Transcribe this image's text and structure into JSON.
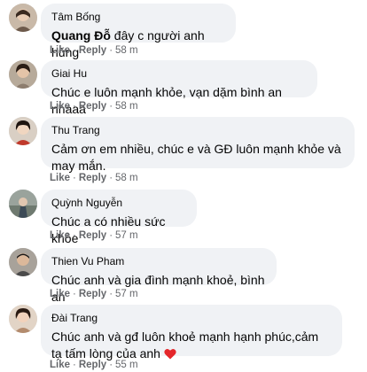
{
  "actions": {
    "like": "Like",
    "reply": "Reply",
    "separator": "·"
  },
  "comments": [
    {
      "author": "Tâm Bống",
      "mention": "Quang Đỗ",
      "text": " đây c người anh hùng",
      "time": "58 m"
    },
    {
      "author": "Giai Hu",
      "text": "Chúc e luôn mạnh khỏe, vạn dặm bình an nhaaa",
      "time": "58 m"
    },
    {
      "author": "Thu Trang",
      "text": "Cảm ơn em nhiều, chúc e và GĐ luôn mạnh khỏe và may mắn.",
      "time": "58 m"
    },
    {
      "author": "Quỳnh Nguyễn",
      "text": "Chúc a có nhiều sức khỏe",
      "time": "57 m"
    },
    {
      "author": "Thien Vu Pham",
      "text": "Chúc anh và gia đình mạnh khoẻ, bình an",
      "time": "57 m"
    },
    {
      "author": "Đài Trang",
      "text": "Chúc anh và gđ luôn khoẻ mạnh hạnh phúc,cảm tạ tấm lòng của anh",
      "time": "55 m",
      "emoji": "red-heart"
    }
  ],
  "colors": {
    "bubble": "#f0f2f5",
    "meta": "#65676b",
    "text": "#050505",
    "heart": "#e4262a"
  }
}
